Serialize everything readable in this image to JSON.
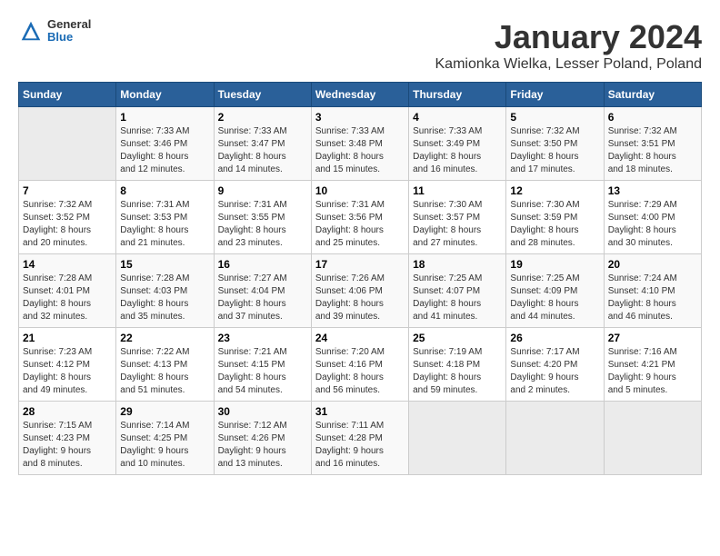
{
  "header": {
    "title": "January 2024",
    "location": "Kamionka Wielka, Lesser Poland, Poland",
    "logo_general": "General",
    "logo_blue": "Blue"
  },
  "days_of_week": [
    "Sunday",
    "Monday",
    "Tuesday",
    "Wednesday",
    "Thursday",
    "Friday",
    "Saturday"
  ],
  "weeks": [
    [
      {
        "num": "",
        "sunrise": "",
        "sunset": "",
        "daylight": ""
      },
      {
        "num": "1",
        "sunrise": "Sunrise: 7:33 AM",
        "sunset": "Sunset: 3:46 PM",
        "daylight": "Daylight: 8 hours and 12 minutes."
      },
      {
        "num": "2",
        "sunrise": "Sunrise: 7:33 AM",
        "sunset": "Sunset: 3:47 PM",
        "daylight": "Daylight: 8 hours and 14 minutes."
      },
      {
        "num": "3",
        "sunrise": "Sunrise: 7:33 AM",
        "sunset": "Sunset: 3:48 PM",
        "daylight": "Daylight: 8 hours and 15 minutes."
      },
      {
        "num": "4",
        "sunrise": "Sunrise: 7:33 AM",
        "sunset": "Sunset: 3:49 PM",
        "daylight": "Daylight: 8 hours and 16 minutes."
      },
      {
        "num": "5",
        "sunrise": "Sunrise: 7:32 AM",
        "sunset": "Sunset: 3:50 PM",
        "daylight": "Daylight: 8 hours and 17 minutes."
      },
      {
        "num": "6",
        "sunrise": "Sunrise: 7:32 AM",
        "sunset": "Sunset: 3:51 PM",
        "daylight": "Daylight: 8 hours and 18 minutes."
      }
    ],
    [
      {
        "num": "7",
        "sunrise": "Sunrise: 7:32 AM",
        "sunset": "Sunset: 3:52 PM",
        "daylight": "Daylight: 8 hours and 20 minutes."
      },
      {
        "num": "8",
        "sunrise": "Sunrise: 7:31 AM",
        "sunset": "Sunset: 3:53 PM",
        "daylight": "Daylight: 8 hours and 21 minutes."
      },
      {
        "num": "9",
        "sunrise": "Sunrise: 7:31 AM",
        "sunset": "Sunset: 3:55 PM",
        "daylight": "Daylight: 8 hours and 23 minutes."
      },
      {
        "num": "10",
        "sunrise": "Sunrise: 7:31 AM",
        "sunset": "Sunset: 3:56 PM",
        "daylight": "Daylight: 8 hours and 25 minutes."
      },
      {
        "num": "11",
        "sunrise": "Sunrise: 7:30 AM",
        "sunset": "Sunset: 3:57 PM",
        "daylight": "Daylight: 8 hours and 27 minutes."
      },
      {
        "num": "12",
        "sunrise": "Sunrise: 7:30 AM",
        "sunset": "Sunset: 3:59 PM",
        "daylight": "Daylight: 8 hours and 28 minutes."
      },
      {
        "num": "13",
        "sunrise": "Sunrise: 7:29 AM",
        "sunset": "Sunset: 4:00 PM",
        "daylight": "Daylight: 8 hours and 30 minutes."
      }
    ],
    [
      {
        "num": "14",
        "sunrise": "Sunrise: 7:28 AM",
        "sunset": "Sunset: 4:01 PM",
        "daylight": "Daylight: 8 hours and 32 minutes."
      },
      {
        "num": "15",
        "sunrise": "Sunrise: 7:28 AM",
        "sunset": "Sunset: 4:03 PM",
        "daylight": "Daylight: 8 hours and 35 minutes."
      },
      {
        "num": "16",
        "sunrise": "Sunrise: 7:27 AM",
        "sunset": "Sunset: 4:04 PM",
        "daylight": "Daylight: 8 hours and 37 minutes."
      },
      {
        "num": "17",
        "sunrise": "Sunrise: 7:26 AM",
        "sunset": "Sunset: 4:06 PM",
        "daylight": "Daylight: 8 hours and 39 minutes."
      },
      {
        "num": "18",
        "sunrise": "Sunrise: 7:25 AM",
        "sunset": "Sunset: 4:07 PM",
        "daylight": "Daylight: 8 hours and 41 minutes."
      },
      {
        "num": "19",
        "sunrise": "Sunrise: 7:25 AM",
        "sunset": "Sunset: 4:09 PM",
        "daylight": "Daylight: 8 hours and 44 minutes."
      },
      {
        "num": "20",
        "sunrise": "Sunrise: 7:24 AM",
        "sunset": "Sunset: 4:10 PM",
        "daylight": "Daylight: 8 hours and 46 minutes."
      }
    ],
    [
      {
        "num": "21",
        "sunrise": "Sunrise: 7:23 AM",
        "sunset": "Sunset: 4:12 PM",
        "daylight": "Daylight: 8 hours and 49 minutes."
      },
      {
        "num": "22",
        "sunrise": "Sunrise: 7:22 AM",
        "sunset": "Sunset: 4:13 PM",
        "daylight": "Daylight: 8 hours and 51 minutes."
      },
      {
        "num": "23",
        "sunrise": "Sunrise: 7:21 AM",
        "sunset": "Sunset: 4:15 PM",
        "daylight": "Daylight: 8 hours and 54 minutes."
      },
      {
        "num": "24",
        "sunrise": "Sunrise: 7:20 AM",
        "sunset": "Sunset: 4:16 PM",
        "daylight": "Daylight: 8 hours and 56 minutes."
      },
      {
        "num": "25",
        "sunrise": "Sunrise: 7:19 AM",
        "sunset": "Sunset: 4:18 PM",
        "daylight": "Daylight: 8 hours and 59 minutes."
      },
      {
        "num": "26",
        "sunrise": "Sunrise: 7:17 AM",
        "sunset": "Sunset: 4:20 PM",
        "daylight": "Daylight: 9 hours and 2 minutes."
      },
      {
        "num": "27",
        "sunrise": "Sunrise: 7:16 AM",
        "sunset": "Sunset: 4:21 PM",
        "daylight": "Daylight: 9 hours and 5 minutes."
      }
    ],
    [
      {
        "num": "28",
        "sunrise": "Sunrise: 7:15 AM",
        "sunset": "Sunset: 4:23 PM",
        "daylight": "Daylight: 9 hours and 8 minutes."
      },
      {
        "num": "29",
        "sunrise": "Sunrise: 7:14 AM",
        "sunset": "Sunset: 4:25 PM",
        "daylight": "Daylight: 9 hours and 10 minutes."
      },
      {
        "num": "30",
        "sunrise": "Sunrise: 7:12 AM",
        "sunset": "Sunset: 4:26 PM",
        "daylight": "Daylight: 9 hours and 13 minutes."
      },
      {
        "num": "31",
        "sunrise": "Sunrise: 7:11 AM",
        "sunset": "Sunset: 4:28 PM",
        "daylight": "Daylight: 9 hours and 16 minutes."
      },
      {
        "num": "",
        "sunrise": "",
        "sunset": "",
        "daylight": ""
      },
      {
        "num": "",
        "sunrise": "",
        "sunset": "",
        "daylight": ""
      },
      {
        "num": "",
        "sunrise": "",
        "sunset": "",
        "daylight": ""
      }
    ]
  ]
}
